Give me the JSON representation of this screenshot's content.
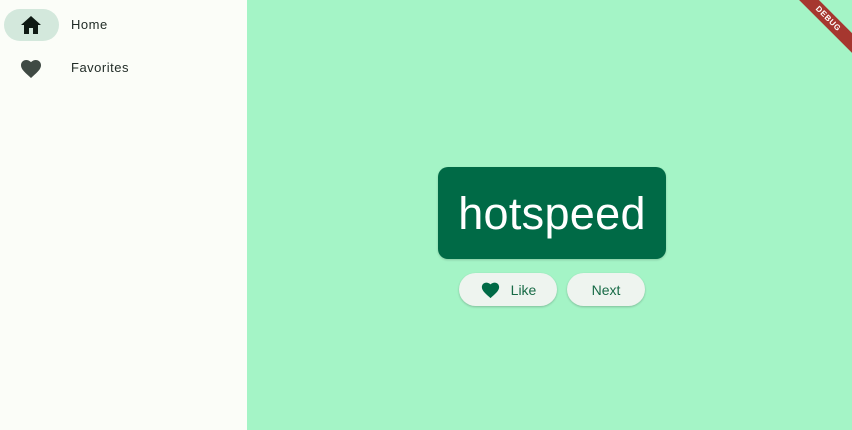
{
  "nav": {
    "items": [
      {
        "label": "Home",
        "icon": "home-icon",
        "selected": true
      },
      {
        "label": "Favorites",
        "icon": "heart-icon",
        "selected": false
      }
    ]
  },
  "main": {
    "word": "hotspeed",
    "like_label": "Like",
    "next_label": "Next"
  },
  "banner": {
    "text": "DEBUG"
  },
  "colors": {
    "background": "#a4f4c6",
    "rail": "#fbfdf8",
    "primary": "#006a46",
    "indicator": "#d3e8dc",
    "button_bg": "#eef4ef",
    "debug_banner": "#a6372f"
  }
}
